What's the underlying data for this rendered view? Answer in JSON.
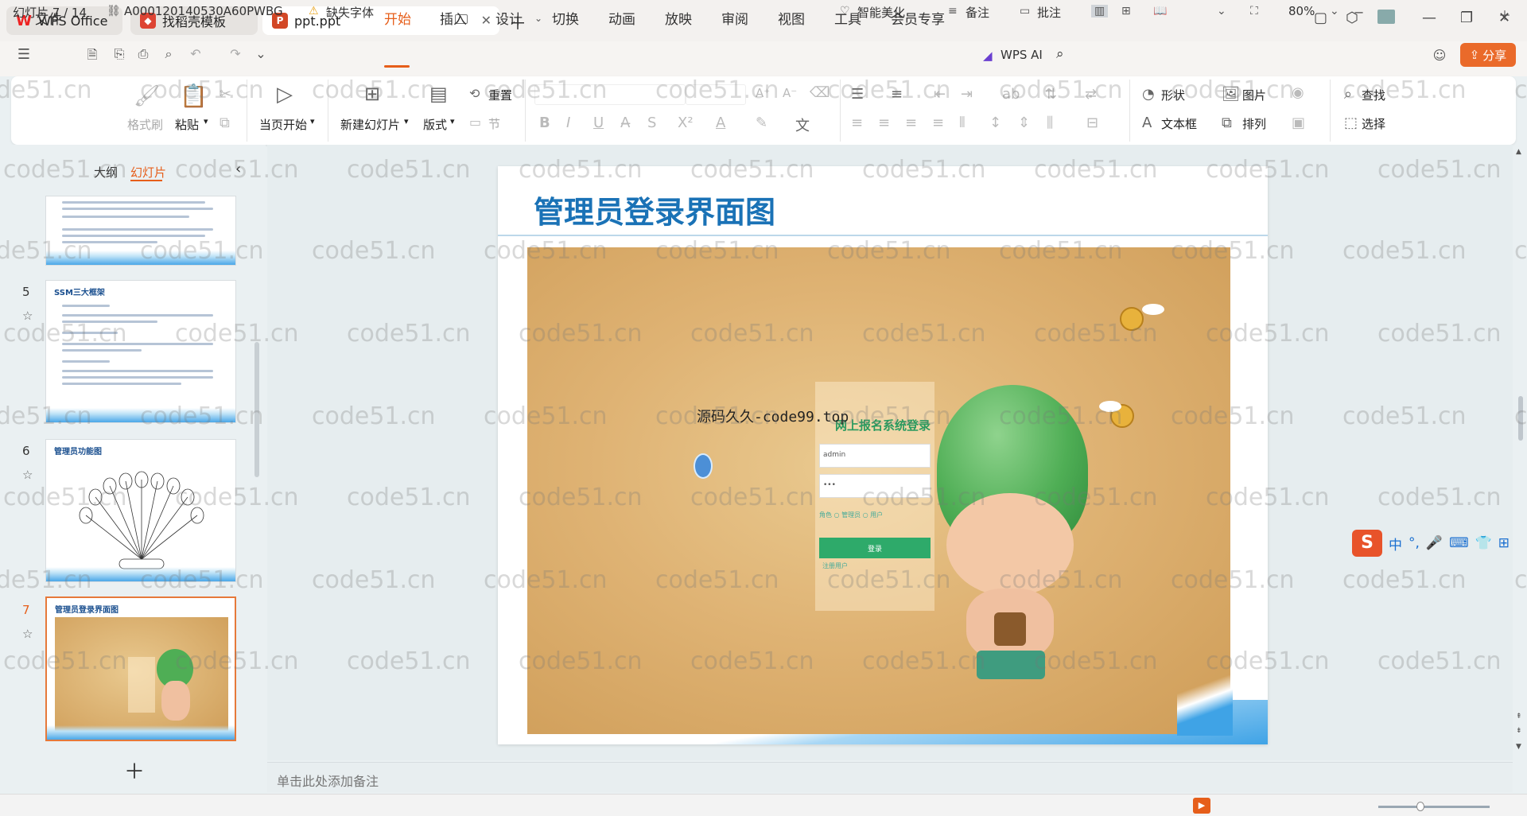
{
  "tabs": [
    {
      "label": "WPS Office",
      "icon": "wps-logo-icon"
    },
    {
      "label": "找稻壳模板",
      "icon": "docer-icon"
    },
    {
      "label": "ppt.ppt",
      "icon": "ppt-file-icon"
    }
  ],
  "menu": {
    "file": "文件",
    "items": [
      "开始",
      "插入",
      "设计",
      "切换",
      "动画",
      "放映",
      "审阅",
      "视图",
      "工具",
      "会员专享"
    ],
    "active": "开始",
    "wps_ai": "WPS AI",
    "share": "分享"
  },
  "ribbon": {
    "format_painter": "格式刷",
    "paste": "粘贴",
    "play_current": "当页开始",
    "new_slide": "新建幻灯片",
    "layout": "版式",
    "reset": "重置",
    "section": "节",
    "shape": "形状",
    "picture": "图片",
    "textbox": "文本框",
    "arrange": "排列",
    "find": "查找",
    "select": "选择"
  },
  "left_panel": {
    "tab_outline": "大纲",
    "tab_slides": "幻灯片",
    "slides": [
      {
        "num": "5",
        "title": "SSM三大框架"
      },
      {
        "num": "6",
        "title": "管理员功能图"
      },
      {
        "num": "7",
        "title": "管理员登录界面图"
      }
    ]
  },
  "slide": {
    "title": "管理员登录界面图",
    "overlay_text": "源码久久-code99.top",
    "login_title": "网上报名系统登录",
    "login_user": "admin",
    "login_pass": "•••",
    "login_roles": "角色  ○ 管理员  ○ 用户",
    "login_button": "登录",
    "login_register": "注册用户"
  },
  "notes_placeholder": "单击此处添加备注",
  "status": {
    "slide_counter": "幻灯片 7 / 14",
    "doc_id": "A000120140530A60PWBG",
    "missing_font": "缺失字体",
    "beautify": "智能美化",
    "notes": "备注",
    "comment": "批注",
    "zoom": "80%"
  },
  "ime": {
    "lang": "中"
  },
  "watermark_text": "code51.cn",
  "colors": {
    "accent": "#e65e1a",
    "title_blue": "#1a72b6",
    "share_bg": "#ea6a2a"
  }
}
